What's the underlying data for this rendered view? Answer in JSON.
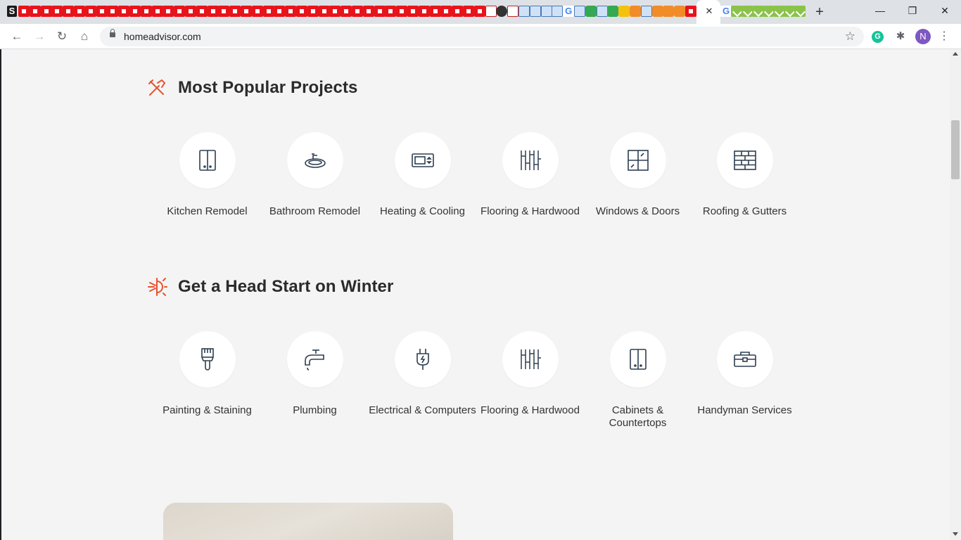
{
  "browser": {
    "active_tab_close": "✕",
    "new_tab": "+",
    "window_controls": {
      "minimize": "—",
      "maximize": "❐",
      "close": "✕"
    },
    "nav": {
      "back": "←",
      "forward": "→",
      "reload": "↻",
      "home": "⌂"
    },
    "address": {
      "url": "homeadvisor.com",
      "bookmark_star": "☆"
    },
    "extensions": {
      "grammarly": "G",
      "puzzle": "✱"
    },
    "profile": {
      "initial": "N",
      "color": "#7e57c2"
    },
    "menu": "⋮"
  },
  "sections": [
    {
      "title": "Most Popular Projects",
      "icon": "tools-icon",
      "items": [
        {
          "label": "Kitchen Remodel",
          "icon": "cabinet-icon"
        },
        {
          "label": "Bathroom Remodel",
          "icon": "sink-icon"
        },
        {
          "label": "Heating & Cooling",
          "icon": "thermostat-icon"
        },
        {
          "label": "Flooring & Hardwood",
          "icon": "flooring-icon"
        },
        {
          "label": "Windows & Doors",
          "icon": "window-icon"
        },
        {
          "label": "Roofing & Gutters",
          "icon": "brick-icon"
        }
      ]
    },
    {
      "title": "Get a Head Start on Winter",
      "icon": "snowflake-sun-icon",
      "items": [
        {
          "label": "Painting & Staining",
          "icon": "paintbrush-icon"
        },
        {
          "label": "Plumbing",
          "icon": "faucet-icon"
        },
        {
          "label": "Electrical & Computers",
          "icon": "plug-icon"
        },
        {
          "label": "Flooring & Hardwood",
          "icon": "flooring-icon"
        },
        {
          "label": "Cabinets & Countertops",
          "icon": "cabinet-icon"
        },
        {
          "label": "Handyman Services",
          "icon": "toolbox-icon"
        }
      ]
    }
  ],
  "colors": {
    "accent": "#e8522f",
    "text": "#2b2b2b",
    "background": "#f4f4f4"
  }
}
